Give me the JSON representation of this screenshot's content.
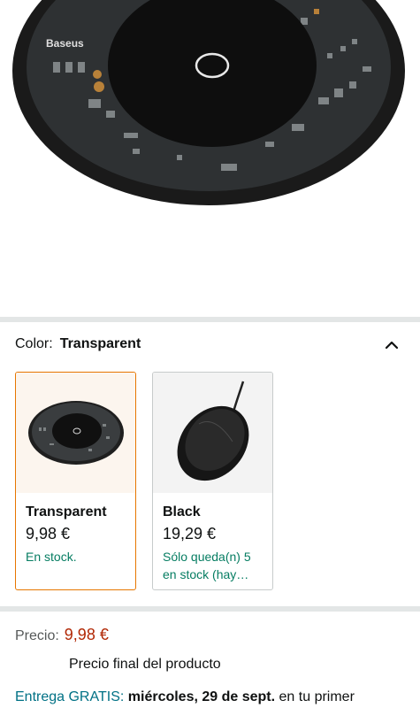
{
  "product": {
    "brand_logo": "Baseus",
    "image_icon": "wireless-charger-transparent"
  },
  "variation": {
    "label": "Color:",
    "selected": "Transparent",
    "toggle_icon": "chevron-up-icon",
    "options": [
      {
        "name": "Transparent",
        "price": "9,98 €",
        "stock": "En stock.",
        "selected": true
      },
      {
        "name": "Black",
        "price": "19,29 €",
        "stock": "Sólo queda(n) 5 en stock (hay…",
        "selected": false
      }
    ]
  },
  "pricing": {
    "label": "Precio:",
    "value": "9,98 €",
    "note": "Precio final del producto"
  },
  "delivery": {
    "prefix": "Entrega GRATIS:",
    "date": "miércoles, 29 de sept.",
    "suffix": "en tu primer"
  },
  "colors": {
    "accent_orange": "#e77600",
    "price_red": "#b12704",
    "stock_green": "#067d62",
    "link_teal": "#007185"
  }
}
